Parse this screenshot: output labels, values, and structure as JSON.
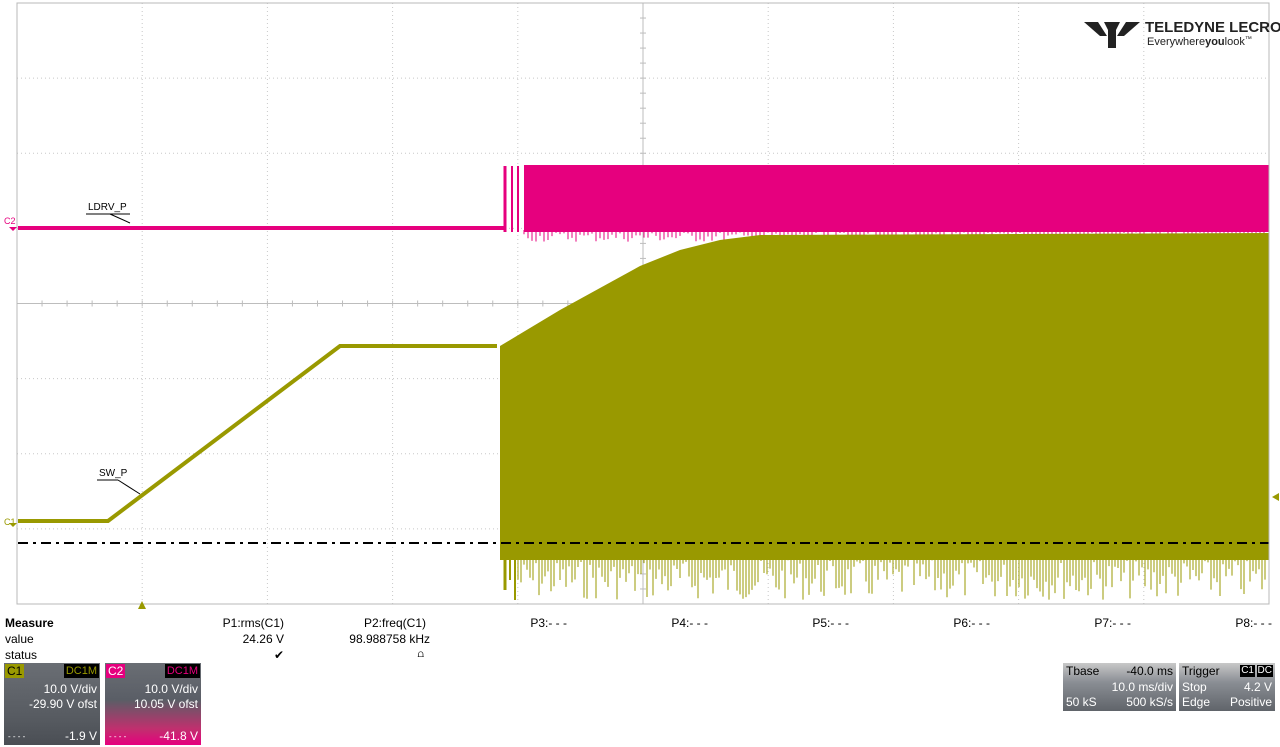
{
  "logo": {
    "brand": "TELEDYNE LECROY",
    "tagline_a": "Everywhere",
    "tagline_b": "you",
    "tagline_c": "look",
    "tm": "™"
  },
  "traces": {
    "c1": {
      "marker": "C1",
      "label": "SW_P",
      "color": "#999900"
    },
    "c2": {
      "marker": "C2",
      "label": "LDRV_P",
      "color": "#e6007e"
    }
  },
  "measure": {
    "heading": "Measure",
    "rows": [
      "value",
      "status"
    ],
    "params": [
      {
        "name": "P1:rms(C1)",
        "value": "24.26 V",
        "status": "✔"
      },
      {
        "name": "P2:freq(C1)",
        "value": "98.988758 kHz",
        "status": "⩍"
      },
      {
        "name": "P3:- - -",
        "value": "",
        "status": ""
      },
      {
        "name": "P4:- - -",
        "value": "",
        "status": ""
      },
      {
        "name": "P5:- - -",
        "value": "",
        "status": ""
      },
      {
        "name": "P6:- - -",
        "value": "",
        "status": ""
      },
      {
        "name": "P7:- - -",
        "value": "",
        "status": ""
      },
      {
        "name": "P8:- - -",
        "value": "",
        "status": ""
      }
    ]
  },
  "channels": {
    "c1": {
      "name": "C1",
      "coupling": "DC1M",
      "vdiv": "10.0 V/div",
      "offset": "-29.90 V ofst",
      "dash": "- - - -",
      "reading": "-1.9 V"
    },
    "c2": {
      "name": "C2",
      "coupling": "DC1M",
      "vdiv": "10.0 V/div",
      "offset": "10.05 V ofst",
      "dash": "- - - -",
      "reading": "-41.8 V"
    }
  },
  "timebase": {
    "label": "Tbase",
    "delay": "-40.0 ms",
    "tdiv": "10.0 ms/div",
    "samples": "50 kS",
    "rate": "500 kS/s"
  },
  "trigger": {
    "label": "Trigger",
    "source": "C1",
    "coupling": "DC",
    "mode": "Stop",
    "level": "4.2 V",
    "type": "Edge",
    "slope": "Positive"
  }
}
